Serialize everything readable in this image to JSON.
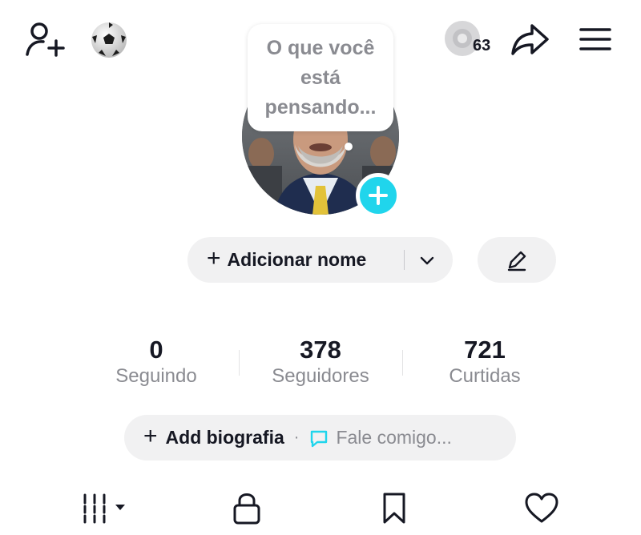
{
  "header": {
    "add_friend_icon": "person-add-icon",
    "badge_icon": "soccer-ball-icon",
    "coins_icon": "coin-icon",
    "coins_count": "63",
    "share_icon": "share-arrow-icon",
    "menu_icon": "hamburger-menu-icon"
  },
  "profile": {
    "thought_bubble": "O que você está pensando...",
    "avatar_add_icon": "plus-icon",
    "add_name_plus": "+",
    "add_name_label": "Adicionar nome",
    "edit_icon": "pencil-icon"
  },
  "stats": [
    {
      "value": "0",
      "label": "Seguindo"
    },
    {
      "value": "378",
      "label": "Seguidores"
    },
    {
      "value": "721",
      "label": "Curtidas"
    }
  ],
  "bio": {
    "plus": "+",
    "add_label": "Add biografia",
    "separator": "·",
    "chat_label": "Fale comigo..."
  },
  "tabs": [
    {
      "icon": "grid-icon"
    },
    {
      "icon": "lock-icon"
    },
    {
      "icon": "bookmark-icon"
    },
    {
      "icon": "heart-icon"
    }
  ],
  "colors": {
    "accent": "#20d5ec",
    "pill_bg": "#f1f1f2",
    "muted_text": "#8a8b91",
    "text": "#161823"
  }
}
